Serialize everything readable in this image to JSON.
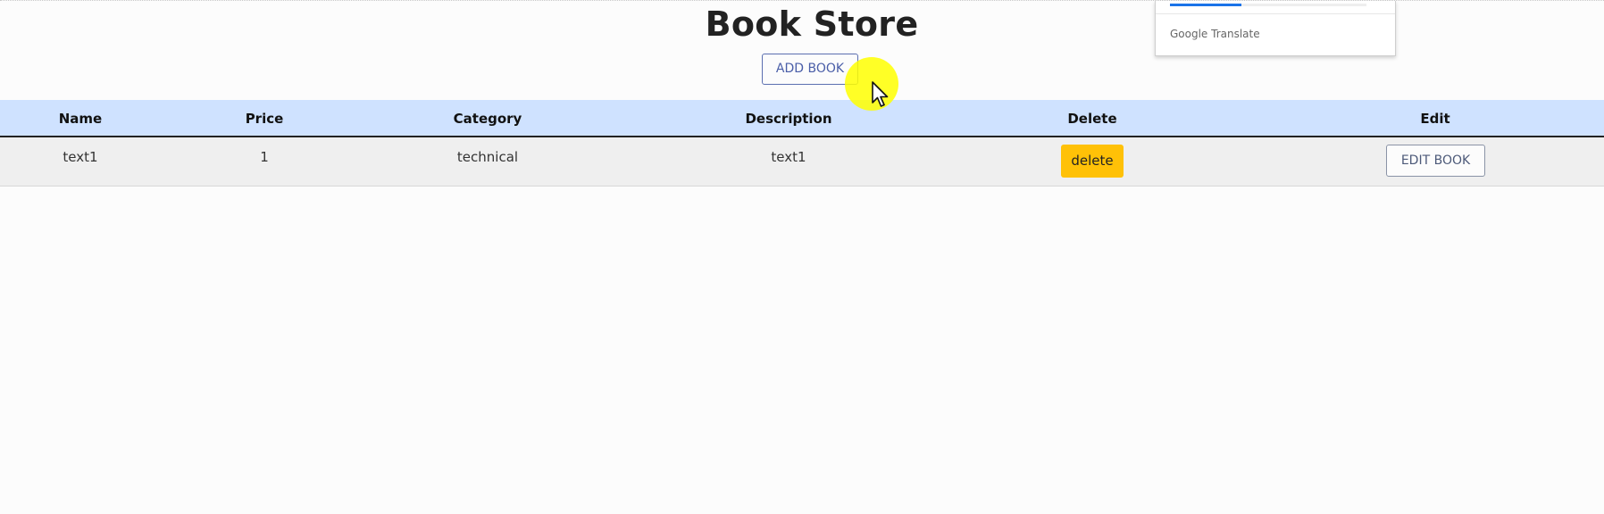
{
  "page": {
    "title": "Book Store"
  },
  "toolbar": {
    "add_book_label": "ADD BOOK"
  },
  "translate_panel": {
    "label": "Google Translate",
    "accent": "#1a73e8"
  },
  "table": {
    "headers": [
      "Name",
      "Price",
      "Category",
      "Description",
      "Delete",
      "Edit"
    ],
    "rows": [
      {
        "name": "text1",
        "price": "1",
        "category": "technical",
        "description": "text1",
        "delete_label": "delete",
        "edit_label": "EDIT BOOK"
      }
    ]
  },
  "colors": {
    "header_background": "#cfe2ff",
    "delete_button": "#ffc107",
    "add_button_border": "#5b6fb0",
    "cursor_highlight": "#ffff00"
  },
  "icons": {
    "cursor": "mouse-pointer-icon"
  }
}
